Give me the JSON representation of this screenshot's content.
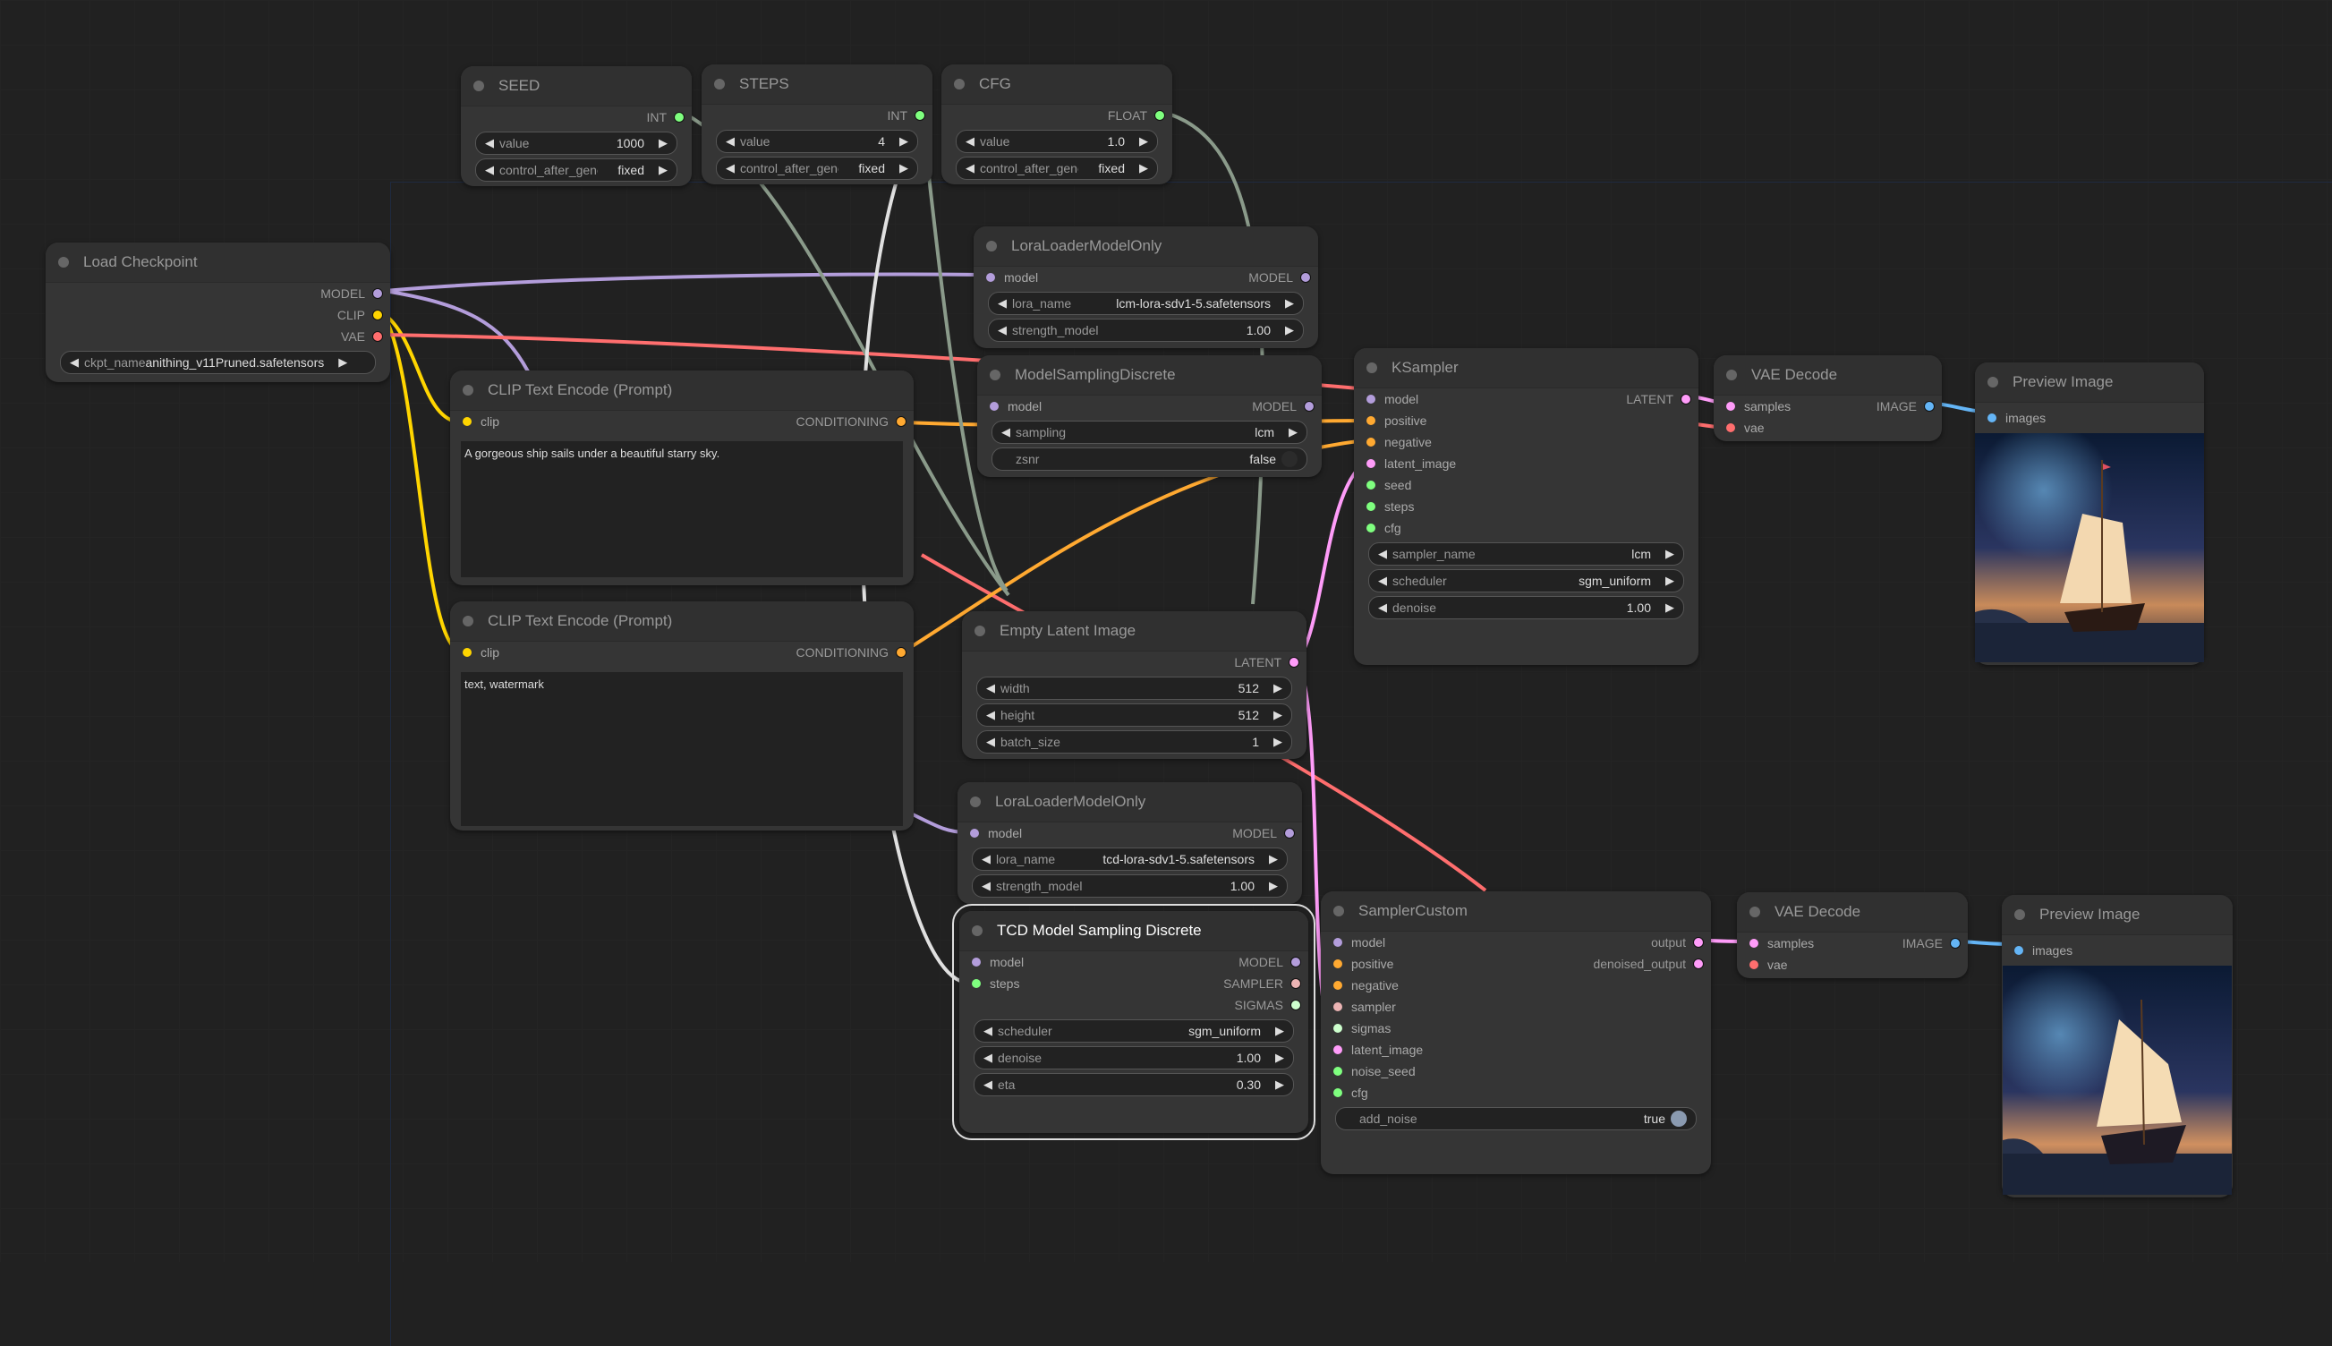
{
  "colors": {
    "model": "#b39ddb",
    "clip": "#ffd500",
    "vae": "#ff6e6e",
    "conditioning": "#ffa931",
    "latent": "#ff9cf9",
    "int": "#7fff7f",
    "image": "#64b5f6",
    "sampler": "#ecb4b4",
    "sigmas": "#cdffcd",
    "link_int": "#8a9a8a"
  },
  "nodes": {
    "seed": {
      "title": "SEED",
      "output": "INT",
      "widgets": [
        {
          "label": "value",
          "value": "1000"
        },
        {
          "label": "control_after_generate",
          "value": "fixed"
        }
      ]
    },
    "steps": {
      "title": "STEPS",
      "output": "INT",
      "widgets": [
        {
          "label": "value",
          "value": "4"
        },
        {
          "label": "control_after_generate",
          "value": "fixed"
        }
      ]
    },
    "cfg": {
      "title": "CFG",
      "output": "FLOAT",
      "widgets": [
        {
          "label": "value",
          "value": "1.0"
        },
        {
          "label": "control_after_generate",
          "value": "fixed"
        }
      ]
    },
    "load_checkpoint": {
      "title": "Load Checkpoint",
      "outputs": [
        "MODEL",
        "CLIP",
        "VAE"
      ],
      "widgets": [
        {
          "label": "ckpt_name",
          "value": "anithing_v11Pruned.safetensors"
        }
      ]
    },
    "lora1": {
      "title": "LoraLoaderModelOnly",
      "input": "model",
      "output": "MODEL",
      "widgets": [
        {
          "label": "lora_name",
          "value": "lcm-lora-sdv1-5.safetensors"
        },
        {
          "label": "strength_model",
          "value": "1.00"
        }
      ]
    },
    "msd": {
      "title": "ModelSamplingDiscrete",
      "input": "model",
      "output": "MODEL",
      "widgets": [
        {
          "label": "sampling",
          "value": "lcm"
        }
      ],
      "toggle": {
        "label": "zsnr",
        "value": "false"
      }
    },
    "clip_pos": {
      "title": "CLIP Text Encode (Prompt)",
      "input": "clip",
      "output": "CONDITIONING",
      "text": "A gorgeous ship sails under a beautiful starry sky."
    },
    "clip_neg": {
      "title": "CLIP Text Encode (Prompt)",
      "input": "clip",
      "output": "CONDITIONING",
      "text": "text, watermark"
    },
    "ksampler": {
      "title": "KSampler",
      "inputs": [
        "model",
        "positive",
        "negative",
        "latent_image",
        "seed",
        "steps",
        "cfg"
      ],
      "output": "LATENT",
      "widgets": [
        {
          "label": "sampler_name",
          "value": "lcm"
        },
        {
          "label": "scheduler",
          "value": "sgm_uniform"
        },
        {
          "label": "denoise",
          "value": "1.00"
        }
      ]
    },
    "vae1": {
      "title": "VAE Decode",
      "inputs": [
        "samples",
        "vae"
      ],
      "output": "IMAGE"
    },
    "preview1": {
      "title": "Preview Image",
      "input": "images"
    },
    "empty_latent": {
      "title": "Empty Latent Image",
      "output": "LATENT",
      "widgets": [
        {
          "label": "width",
          "value": "512"
        },
        {
          "label": "height",
          "value": "512"
        },
        {
          "label": "batch_size",
          "value": "1"
        }
      ]
    },
    "lora2": {
      "title": "LoraLoaderModelOnly",
      "input": "model",
      "output": "MODEL",
      "widgets": [
        {
          "label": "lora_name",
          "value": "tcd-lora-sdv1-5.safetensors"
        },
        {
          "label": "strength_model",
          "value": "1.00"
        }
      ]
    },
    "tcd": {
      "title": "TCD Model Sampling Discrete",
      "inputs": [
        "model",
        "steps"
      ],
      "outputs": [
        "MODEL",
        "SAMPLER",
        "SIGMAS"
      ],
      "widgets": [
        {
          "label": "scheduler",
          "value": "sgm_uniform"
        },
        {
          "label": "denoise",
          "value": "1.00"
        },
        {
          "label": "eta",
          "value": "0.30"
        }
      ]
    },
    "sampler_custom": {
      "title": "SamplerCustom",
      "inputs": [
        "model",
        "positive",
        "negative",
        "sampler",
        "sigmas",
        "latent_image",
        "noise_seed",
        "cfg"
      ],
      "outputs": [
        "output",
        "denoised_output"
      ],
      "toggle": {
        "label": "add_noise",
        "value": "true"
      }
    },
    "vae2": {
      "title": "VAE Decode",
      "inputs": [
        "samples",
        "vae"
      ],
      "output": "IMAGE"
    },
    "preview2": {
      "title": "Preview Image",
      "input": "images"
    }
  },
  "icons": {
    "left_arrow": "◀",
    "right_arrow": "▶"
  }
}
